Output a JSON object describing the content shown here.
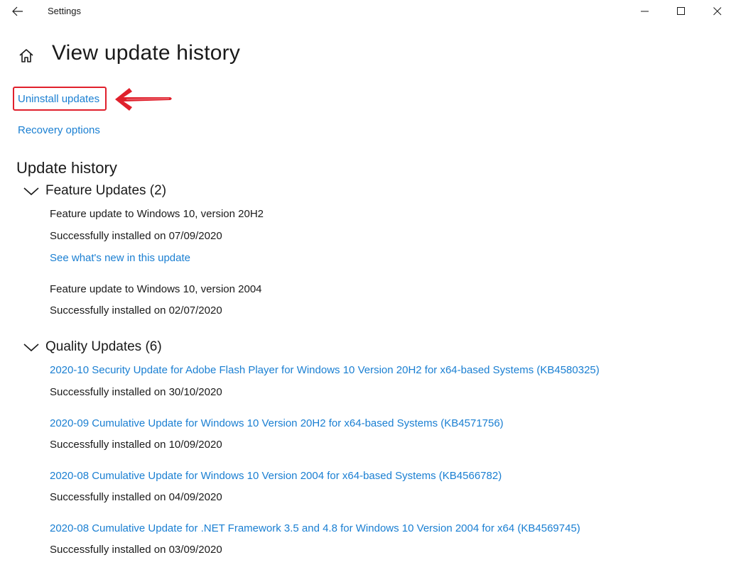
{
  "window": {
    "title": "Settings",
    "controls": {
      "minimize_icon": "minimize-icon",
      "maximize_icon": "maximize-icon",
      "close_icon": "close-icon"
    }
  },
  "header": {
    "title": "View update history",
    "home_icon": "home-icon"
  },
  "links": {
    "uninstall": "Uninstall updates",
    "recovery": "Recovery options"
  },
  "annotation": {
    "highlight_color": "#e0202c"
  },
  "history": {
    "heading": "Update history",
    "feature": {
      "label": "Feature Updates (2)",
      "items": [
        {
          "name": "Feature update to Windows 10, version 20H2",
          "status": "Successfully installed on 07/09/2020",
          "link": "See what's new in this update"
        },
        {
          "name": "Feature update to Windows 10, version 2004",
          "status": "Successfully installed on 02/07/2020"
        }
      ]
    },
    "quality": {
      "label": "Quality Updates (6)",
      "items": [
        {
          "name": "2020-10 Security Update for Adobe Flash Player for Windows 10 Version 20H2 for x64-based Systems (KB4580325)",
          "status": "Successfully installed on 30/10/2020"
        },
        {
          "name": "2020-09 Cumulative Update for Windows 10 Version 20H2 for x64-based Systems (KB4571756)",
          "status": "Successfully installed on 10/09/2020"
        },
        {
          "name": "2020-08 Cumulative Update for Windows 10 Version 2004 for x64-based Systems (KB4566782)",
          "status": "Successfully installed on 04/09/2020"
        },
        {
          "name": "2020-08 Cumulative Update for .NET Framework 3.5 and 4.8 for Windows 10 Version 2004 for x64 (KB4569745)",
          "status": "Successfully installed on 03/09/2020"
        }
      ]
    }
  },
  "colors": {
    "link": "#1a7fd2",
    "text": "#1a1a1a",
    "background": "#ffffff"
  }
}
